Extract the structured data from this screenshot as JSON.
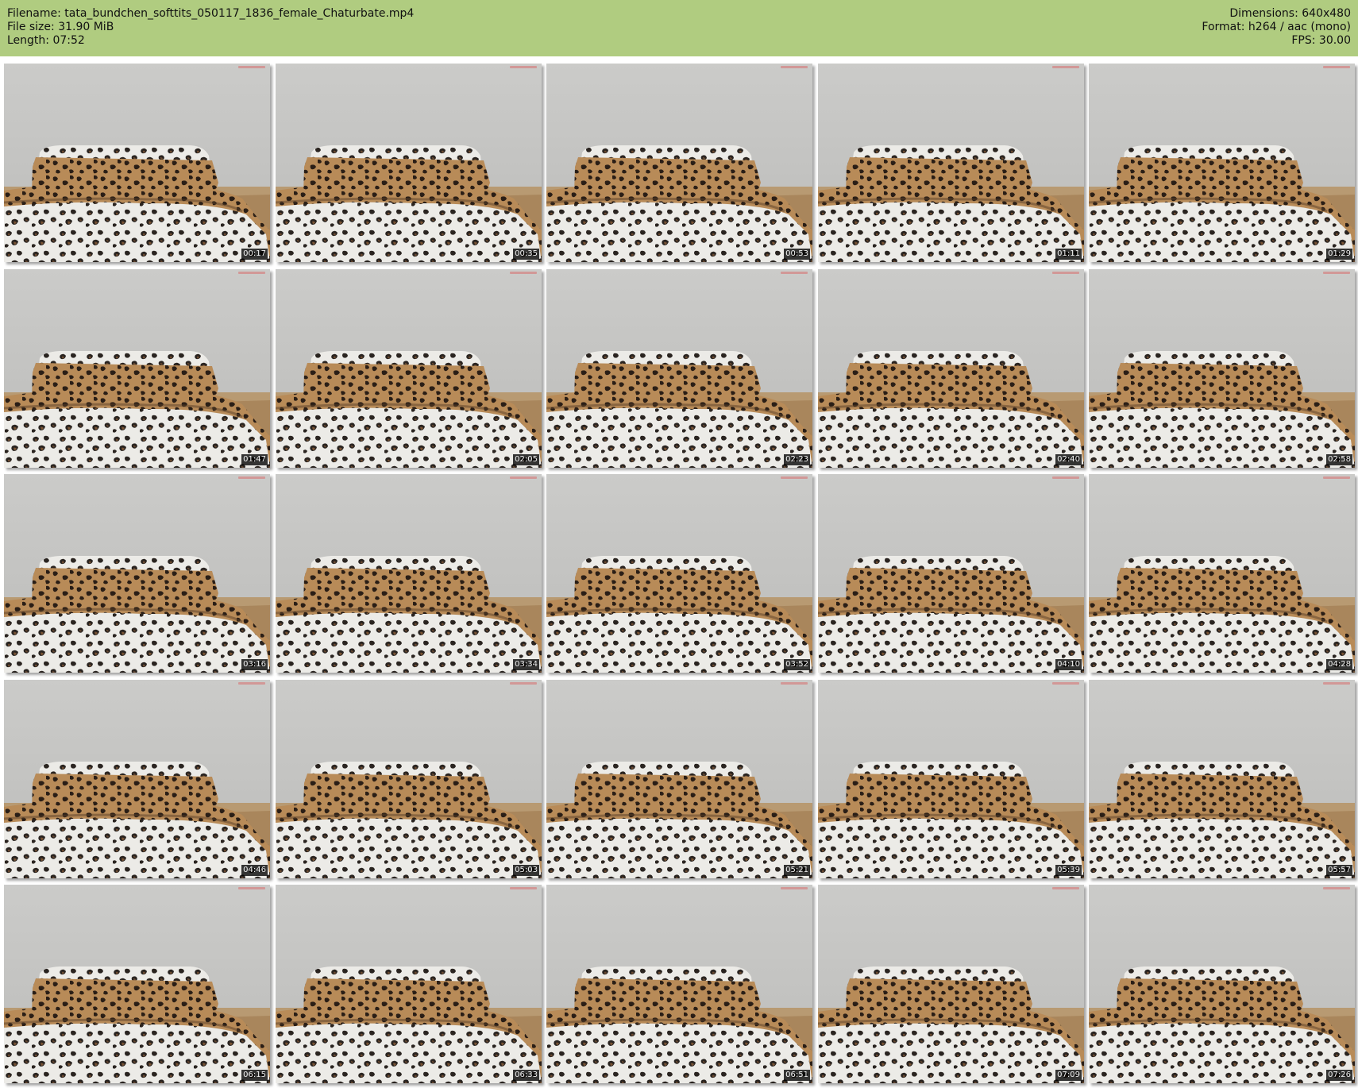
{
  "header": {
    "filename_line": "Filename: tata_bundchen_softtits_050117_1836_female_Chaturbate.mp4",
    "filesize_line": "File size: 31.90 MiB",
    "length_line": "Length: 07:52",
    "dimensions_line": "Dimensions: 640x480",
    "format_line": "Format: h264 / aac (mono)",
    "fps_line": "FPS: 30.00"
  },
  "colors": {
    "header_bg": "#b0cc80",
    "timestamp_bg": "#000000"
  },
  "thumbnails": [
    "00:17",
    "00:35",
    "00:53",
    "01:11",
    "01:29",
    "01:47",
    "02:05",
    "02:23",
    "02:40",
    "02:58",
    "03:16",
    "03:34",
    "03:52",
    "04:10",
    "04:28",
    "04:46",
    "05:03",
    "05:21",
    "05:39",
    "05:57",
    "06:15",
    "06:33",
    "06:51",
    "07:09",
    "07:26"
  ]
}
